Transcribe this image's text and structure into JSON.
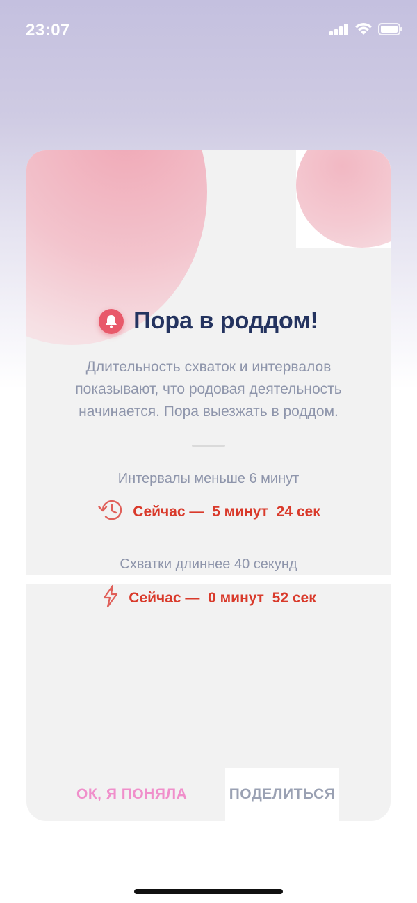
{
  "status_bar": {
    "time": "23:07",
    "icons": [
      "signal-icon",
      "wifi-icon",
      "battery-icon"
    ]
  },
  "dialog": {
    "icon": "bell-icon",
    "title": "Пора в роддом!",
    "description": "Длительность схваток и интервалов показывают, что родовая деятельность начинается. Пора выезжать в роддом.",
    "metrics": [
      {
        "icon": "history-clock-icon",
        "label": "Интервалы меньше 6 минут",
        "value": "Сейчас —  5 минут  24 сек"
      },
      {
        "icon": "lightning-icon",
        "label": "Схватки длиннее 40 секунд",
        "value": "Сейчас —  0 минут  52 сек"
      }
    ],
    "buttons": {
      "ok": "ОК, Я ПОНЯЛА",
      "share": "ПОДЕЛИТЬСЯ"
    }
  },
  "colors": {
    "title": "#24335f",
    "accent_red": "#d93a2b",
    "ok_pink": "#f08fcb",
    "muted_text": "#8e95ab",
    "card_bg": "#f2f2f2"
  }
}
